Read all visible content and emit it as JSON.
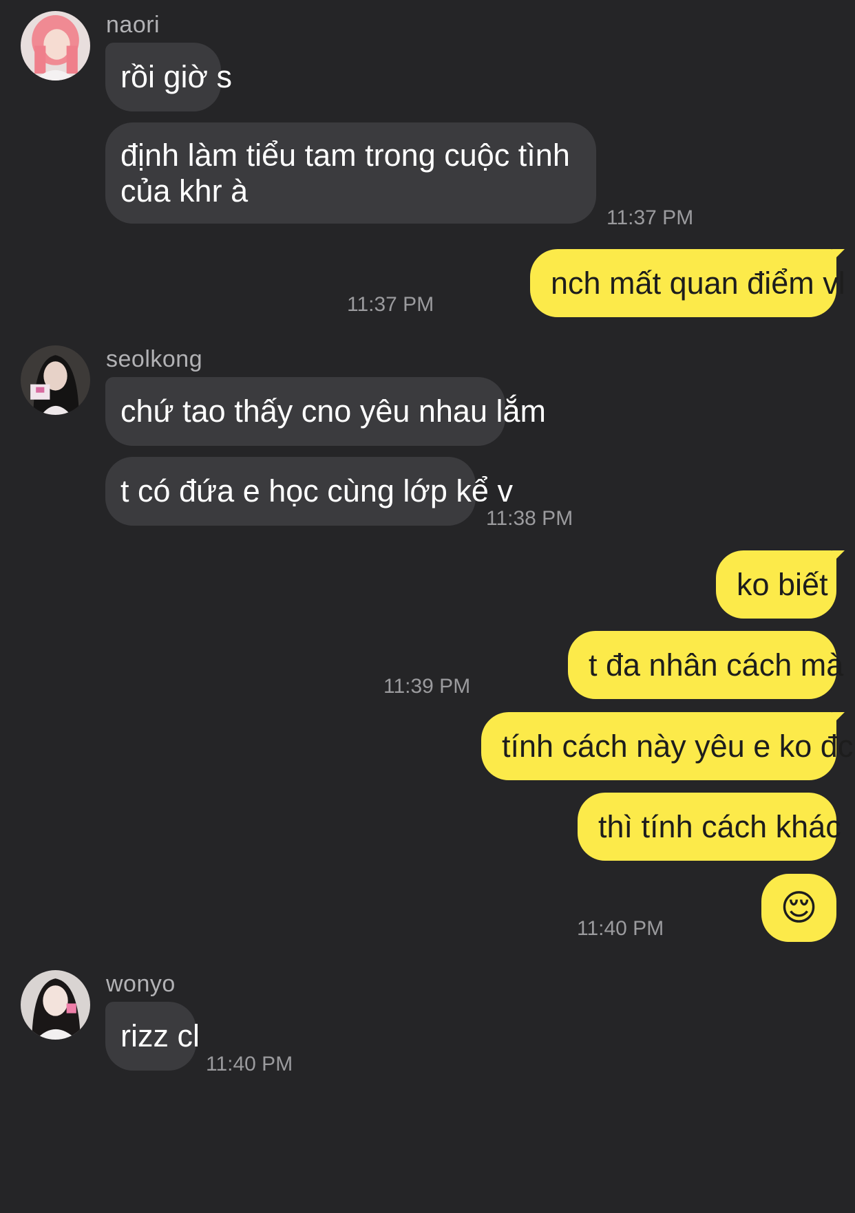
{
  "chat": {
    "groups": [
      {
        "sender": "naori",
        "messages": [
          "rồi giờ s",
          "định làm tiểu tam trong cuộc tình của khr à"
        ],
        "time": "11:37 PM"
      },
      {
        "sender": "me",
        "messages": [
          "nch mất quan điểm vl"
        ],
        "time": "11:37 PM"
      },
      {
        "sender": "seolkong",
        "messages": [
          "chứ tao thấy cno yêu nhau lắm",
          "t có đứa e học cùng lớp kể v"
        ],
        "time": "11:38 PM"
      },
      {
        "sender": "me",
        "messages": [
          "ko biết",
          "t đa nhân cách mà"
        ],
        "time": "11:39 PM"
      },
      {
        "sender": "me",
        "messages": [
          "tính cách này yêu e ko đc",
          "thì tính cách khác",
          "😌"
        ],
        "time": "11:40 PM"
      },
      {
        "sender": "wonyo",
        "messages": [
          "rizz cl"
        ],
        "time": "11:40 PM"
      }
    ]
  },
  "colors": {
    "background": "#252527",
    "incoming_bubble": "#3b3b3e",
    "outgoing_bubble": "#fcea4a",
    "timestamp": "#9b9b9e",
    "sender_name": "#b2b2b5"
  }
}
